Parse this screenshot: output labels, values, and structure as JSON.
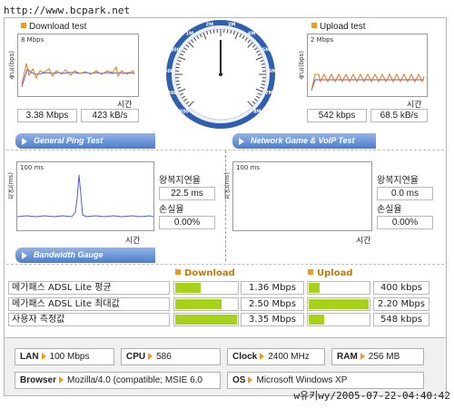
{
  "watermark_top": "http://www.bcpark.net",
  "watermark_bottom": "w유키wy/2005-07-22-04:40:42",
  "download": {
    "title": "Download test",
    "scale": "8 Mbps",
    "ylabel": "속도(bps)",
    "xlabel": "시간",
    "mbps": "3.38 Mbps",
    "kbs": "423 kB/s"
  },
  "upload": {
    "title": "Upload test",
    "scale": "2 Mbps",
    "ylabel": "속도(bps)",
    "xlabel": "시간",
    "kbps": "542 kbps",
    "kbs": "68.5 kB/s"
  },
  "gauge": {
    "ticks": [
      "200",
      "400",
      "600",
      "800",
      "1M",
      "2M",
      "3M",
      "4M",
      "5M",
      "6M",
      "7M",
      "8M"
    ],
    "needle_value": "3.38 Mbps"
  },
  "ping": {
    "banner": "General Ping Test",
    "scale": "100 ms",
    "ylabel": "지연(ms)",
    "xlabel": "시간",
    "rtt_label": "왕복지연율",
    "rtt_value": "22.5 ms",
    "loss_label": "손실율",
    "loss_value": "0.00%"
  },
  "game": {
    "banner": "Network Game & VoIP Test",
    "scale": "100 ms",
    "ylabel": "지연(ms)",
    "xlabel": "시간",
    "rtt_label": "왕복지연율",
    "rtt_value": "0.0 ms",
    "loss_label": "손실율",
    "loss_value": "0.00%"
  },
  "bandwidth": {
    "banner": "Bandwidth Gauge",
    "download_header": "Download",
    "upload_header": "Upload",
    "rows": [
      {
        "label": "메가패스 ADSL Lite 평균",
        "dl_value": "1.36 Mbps",
        "dl_fill": 0.41,
        "ul_value": "400 kbps",
        "ul_fill": 0.18
      },
      {
        "label": "메가패스 ADSL Lite 최대값",
        "dl_value": "2.50 Mbps",
        "dl_fill": 0.75,
        "ul_value": "2.20 Mbps",
        "ul_fill": 1.0
      },
      {
        "label": "사용자 측정값",
        "dl_value": "3.35 Mbps",
        "dl_fill": 1.0,
        "ul_value": "548 kbps",
        "ul_fill": 0.25
      }
    ]
  },
  "system": {
    "lan_key": "LAN",
    "lan_value": "100 Mbps",
    "cpu_key": "CPU",
    "cpu_value": "586",
    "clock_key": "Clock",
    "clock_value": "2400 MHz",
    "ram_key": "RAM",
    "ram_value": "256 MB",
    "browser_key": "Browser",
    "browser_value": "Mozilla/4.0 (compatible; MSIE 6.0",
    "os_key": "OS",
    "os_value": "Microsoft Windows XP"
  },
  "colors": {
    "accent_orange": "#f39a1e",
    "banner_blue": "#4e7cc9",
    "bar_green": "#a6d31a",
    "gauge_blue": "#2f5fae"
  }
}
